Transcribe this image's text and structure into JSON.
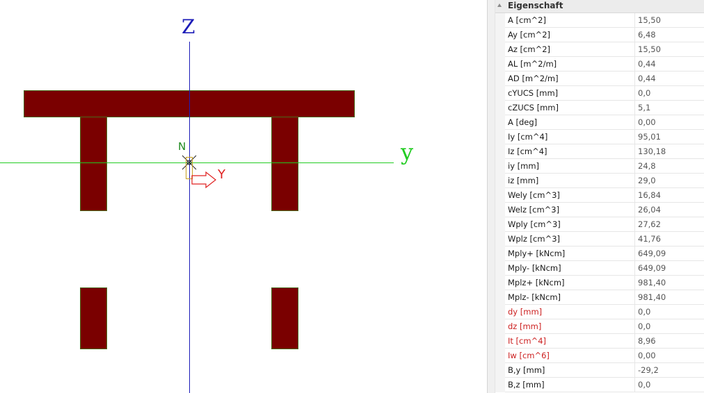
{
  "drawing": {
    "axis_z_label": "Z",
    "axis_y_label": "y",
    "local_z_label": "N",
    "local_y_label": "Y",
    "colors": {
      "section_fill": "#7a0000",
      "section_edge": "#4a6b1a",
      "axis_z": "#1c1cb8",
      "axis_y": "#22cc22",
      "local_y": "#e02020",
      "local_z": "#1e8a1e"
    }
  },
  "properties": {
    "header": "Eigenschaft",
    "rows": [
      {
        "name": "A [cm^2]",
        "value": "15,50",
        "highlight": false
      },
      {
        "name": "Ay [cm^2]",
        "value": "6,48",
        "highlight": false
      },
      {
        "name": "Az [cm^2]",
        "value": "15,50",
        "highlight": false
      },
      {
        "name": "AL [m^2/m]",
        "value": "0,44",
        "highlight": false
      },
      {
        "name": "AD [m^2/m]",
        "value": "0,44",
        "highlight": false
      },
      {
        "name": "cYUCS [mm]",
        "value": "0,0",
        "highlight": false
      },
      {
        "name": "cZUCS [mm]",
        "value": "5,1",
        "highlight": false
      },
      {
        "name": "A [deg]",
        "value": "0,00",
        "highlight": false
      },
      {
        "name": "Iy [cm^4]",
        "value": "95,01",
        "highlight": false
      },
      {
        "name": "Iz [cm^4]",
        "value": "130,18",
        "highlight": false
      },
      {
        "name": "iy [mm]",
        "value": "24,8",
        "highlight": false
      },
      {
        "name": "iz [mm]",
        "value": "29,0",
        "highlight": false
      },
      {
        "name": "Wely [cm^3]",
        "value": "16,84",
        "highlight": false
      },
      {
        "name": "Welz [cm^3]",
        "value": "26,04",
        "highlight": false
      },
      {
        "name": "Wply [cm^3]",
        "value": "27,62",
        "highlight": false
      },
      {
        "name": "Wplz [cm^3]",
        "value": "41,76",
        "highlight": false
      },
      {
        "name": "Mply+ [kNcm]",
        "value": "649,09",
        "highlight": false
      },
      {
        "name": "Mply- [kNcm]",
        "value": "649,09",
        "highlight": false
      },
      {
        "name": "Mplz+ [kNcm]",
        "value": "981,40",
        "highlight": false
      },
      {
        "name": "Mplz- [kNcm]",
        "value": "981,40",
        "highlight": false
      },
      {
        "name": "dy [mm]",
        "value": "0,0",
        "highlight": true
      },
      {
        "name": "dz [mm]",
        "value": "0,0",
        "highlight": true
      },
      {
        "name": "It [cm^4]",
        "value": "8,96",
        "highlight": true
      },
      {
        "name": "Iw [cm^6]",
        "value": "0,00",
        "highlight": true
      },
      {
        "name": "B,y [mm]",
        "value": "-29,2",
        "highlight": false
      },
      {
        "name": "B,z [mm]",
        "value": "0,0",
        "highlight": false
      }
    ]
  }
}
